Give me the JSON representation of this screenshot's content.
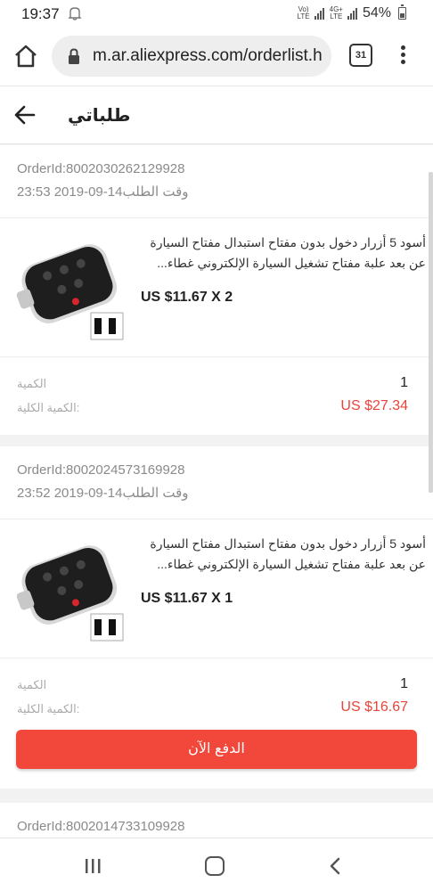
{
  "status_bar": {
    "time": "19:37",
    "network_top": "Vo)",
    "network_bottom": "LTE",
    "net2_top": "4G+",
    "net2_bottom": "LTE",
    "battery": "54%"
  },
  "browser": {
    "url": "m.ar.aliexpress.com/orderlist.h",
    "tab_count": "31"
  },
  "header": {
    "title": "طلباتي"
  },
  "orders": [
    {
      "order_id": "OrderId:8002030262129928",
      "order_time": "وقت الطلب14-09-2019 23:53",
      "title_line1": "أسود 5 أزرار دخول بدون مفتاح استبدال مفتاح السيارة",
      "title_line2": "عن بعد علبة مفتاح تشغيل السيارة الإلكتروني غطاء...",
      "price": "US $11.67 X 2",
      "qty_label": "الكمية",
      "qty_value": "1",
      "total_label": "الكمية الكلية:",
      "total_value": "US $27.34"
    },
    {
      "order_id": "OrderId:8002024573169928",
      "order_time": "وقت الطلب14-09-2019 23:52",
      "title_line1": "أسود 5 أزرار دخول بدون مفتاح استبدال مفتاح السيارة",
      "title_line2": "عن بعد علبة مفتاح تشغيل السيارة الإلكتروني غطاء...",
      "price": "US $11.67 X 1",
      "qty_label": "الكمية",
      "qty_value": "1",
      "total_label": "الكمية الكلية:",
      "total_value": "US $16.67",
      "pay_label": "الدفع الآن"
    },
    {
      "order_id": "OrderId:8002014733109928"
    }
  ],
  "colors": {
    "accent": "#f2473b",
    "price_red": "#e8443a",
    "muted_text": "#8a8a8a"
  },
  "icons": {
    "home": "home-icon",
    "lock": "lock-icon",
    "menu": "more-vert-icon",
    "back": "arrow-back-icon"
  }
}
